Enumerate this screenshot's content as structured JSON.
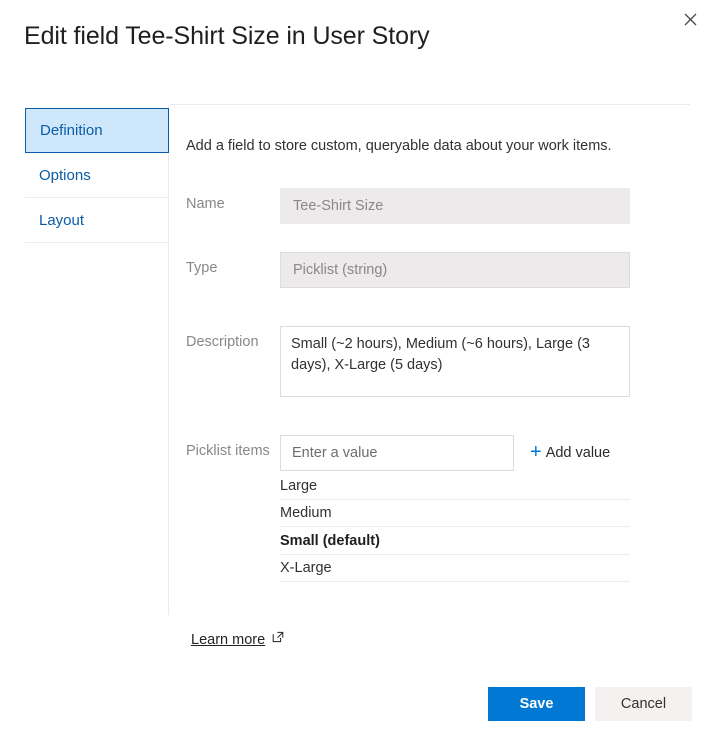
{
  "dialog": {
    "title": "Edit field Tee-Shirt Size in User Story",
    "close_icon": "close-icon"
  },
  "tabs": [
    {
      "label": "Definition",
      "selected": true
    },
    {
      "label": "Options",
      "selected": false
    },
    {
      "label": "Layout",
      "selected": false
    }
  ],
  "content": {
    "intro": "Add a field to store custom, queryable data about your work items.",
    "fields": {
      "name": {
        "label": "Name",
        "value": "Tee-Shirt Size",
        "readonly": true
      },
      "type": {
        "label": "Type",
        "value": "Picklist (string)",
        "readonly": true
      },
      "description": {
        "label": "Description",
        "value": "Small (~2 hours), Medium (~6 hours), Large (3 days), X-Large (5 days)"
      },
      "picklist": {
        "label": "Picklist items",
        "input_placeholder": "Enter a value",
        "input_value": "",
        "add_value_label": "Add value",
        "add_value_icon": "plus-icon",
        "items": [
          {
            "label": "Large",
            "default": false
          },
          {
            "label": "Medium",
            "default": false
          },
          {
            "label": "Small (default)",
            "default": true
          },
          {
            "label": "X-Large",
            "default": false
          }
        ]
      }
    },
    "learn_more": {
      "label": "Learn more",
      "icon": "external-link-icon"
    }
  },
  "footer": {
    "save_label": "Save",
    "cancel_label": "Cancel"
  },
  "colors": {
    "accent": "#0078d4",
    "tab_selected_bg": "#cfe7fa",
    "tab_selected_border": "#0a5ca8",
    "readonly_bg": "#eceaea",
    "cancel_bg": "#f3f2f1"
  }
}
